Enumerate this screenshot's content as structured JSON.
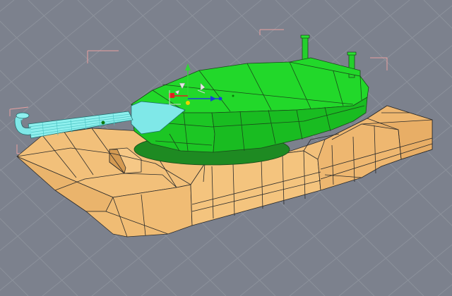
{
  "viewport": {
    "background": "#7c818d",
    "grid_color": "#8c919b",
    "wire_color": "#2a2a2a",
    "model": {
      "hull_color": "#f2c07a",
      "hull_shade_color": "#e3a95e",
      "turret_color": "#22d82a",
      "turret_shade_color": "#15b91e",
      "barrel_selected_color": "#7fe8e8"
    },
    "gizmo": {
      "y_axis_color": "#34d13a",
      "x_axis_color": "#e02020",
      "z_axis_color": "#1a3ed8",
      "pivot_color": "#f0d000"
    },
    "bounding_box_color": "#e8a0a0"
  }
}
